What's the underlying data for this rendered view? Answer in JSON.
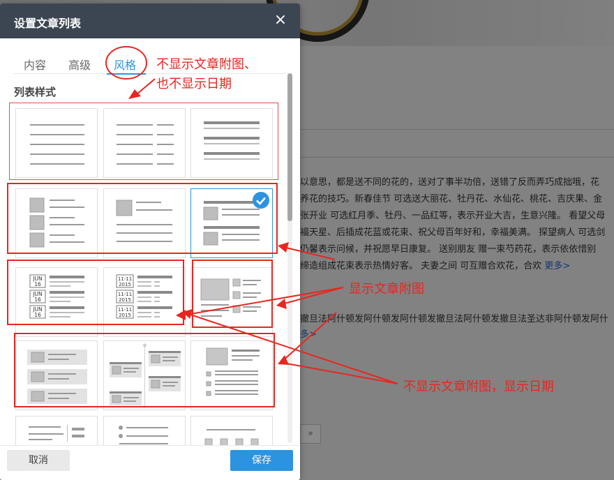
{
  "background": {
    "text_lines": [
      "以意思，都是送不同的花的，送对了事半功倍，送错了反而弄巧成拙哦，花",
      "养花的技巧。新春佳节 可选送大丽花、牡丹花、水仙花、桃花、吉庆果、金",
      "张开业 可选红月季、牡丹、一品红等，表示开业大吉，生意兴隆。 看望父母",
      "福天星、后插成花蓝或花束、祝父母百年好和，幸福美满。 探望病人 可选剑",
      "仍馨表示问候，并祝愿早日康复。 送别朋友 赠一束芍药花，表示依依惜别",
      "缔造组成花束表示热情好客。 夫妻之间 可互赠合欢花，合欢 "
    ],
    "more_link": "更多>",
    "text_line_2": "撤旦法阿什顿发阿什顿发阿什顿发撤旦法阿什顿发撤旦法圣达非阿什顿发阿什",
    "more_link_2": "多>",
    "pager_next": "»"
  },
  "dialog": {
    "title": "设置文章列表",
    "close_glyph": "×",
    "tabs": [
      {
        "label": "内容",
        "active": false
      },
      {
        "label": "高级",
        "active": false
      },
      {
        "label": "风格",
        "active": true
      }
    ],
    "section_title": "列表样式",
    "selected_style_index": 5,
    "styles_count": 15,
    "date_badges": {
      "month": "JUN",
      "day": "16",
      "range": "11-11",
      "year": "2015"
    },
    "buttons": {
      "cancel": "取消",
      "save": "保存"
    }
  },
  "annotations": {
    "no_image_no_date_line1": "不显示文章附图、",
    "no_image_no_date_line2": "也不显示日期",
    "show_image": "显示文章附图",
    "no_image_show_date": "不显示文章附图，显示日期"
  },
  "colors": {
    "accent": "#2c93e0",
    "header": "#3c4653",
    "annotation_red": "#e8261f"
  }
}
